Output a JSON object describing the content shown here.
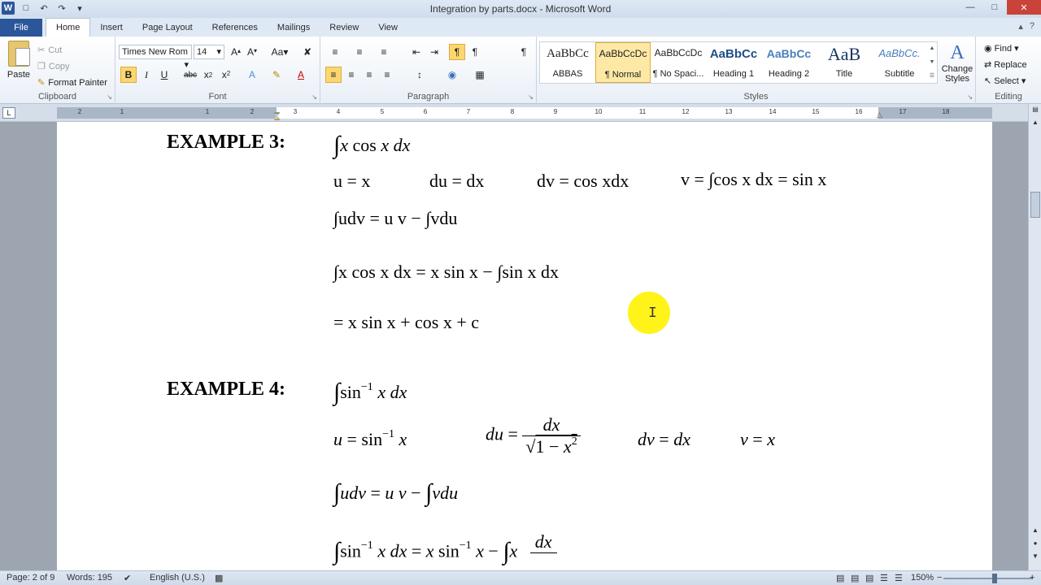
{
  "app": {
    "window_title": "Integration by parts.docx - Microsoft Word",
    "app_icon": "W"
  },
  "tabs": [
    "File",
    "Home",
    "Insert",
    "Page Layout",
    "References",
    "Mailings",
    "Review",
    "View"
  ],
  "ribbon": {
    "clipboard": {
      "label": "Clipboard",
      "paste": "Paste",
      "cut": "Cut",
      "copy": "Copy",
      "format_painter": "Format Painter"
    },
    "font": {
      "label": "Font",
      "name": "Times New Rom",
      "size": "14"
    },
    "paragraph": {
      "label": "Paragraph"
    },
    "styles": {
      "label": "Styles",
      "items": [
        {
          "preview": "AaBbCc",
          "name": "ABBAS"
        },
        {
          "preview": "AaBbCcDc",
          "name": "¶ Normal"
        },
        {
          "preview": "AaBbCcDc",
          "name": "¶ No Spaci..."
        },
        {
          "preview": "AaBbCc",
          "name": "Heading 1"
        },
        {
          "preview": "AaBbCc",
          "name": "Heading 2"
        },
        {
          "preview": "AaB",
          "name": "Title"
        },
        {
          "preview": "AaBbCc.",
          "name": "Subtitle"
        }
      ],
      "change_styles": "Change Styles"
    },
    "editing": {
      "label": "Editing",
      "find": "Find",
      "replace": "Replace",
      "select": "Select"
    }
  },
  "ruler_numbers": [
    "2",
    "1",
    "1",
    "2",
    "3",
    "4",
    "5",
    "6",
    "7",
    "8",
    "9",
    "10",
    "11",
    "12",
    "13",
    "14",
    "15",
    "16",
    "17",
    "18"
  ],
  "document": {
    "example3": {
      "label": "EXAMPLE 3:",
      "u": "u = x",
      "du": "du = dx",
      "dv": "dv = cos xdx",
      "v": "v = ∫cos x dx = sin x",
      "formula": "∫udv = u v − ∫vdu",
      "step": "∫x cos x dx = x sin x − ∫sin x dx",
      "result": "= x sin x + cos x + c"
    },
    "example4": {
      "label": "EXAMPLE 4:"
    }
  },
  "status": {
    "page": "Page: 2 of 9",
    "words": "Words: 195",
    "language": "English (U.S.)",
    "zoom": "150%"
  }
}
